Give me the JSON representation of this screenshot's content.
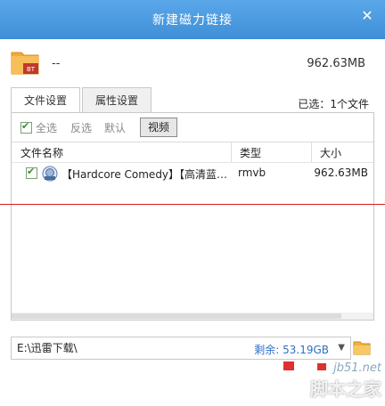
{
  "window": {
    "title": "新建磁力链接",
    "close_glyph": "✕"
  },
  "torrent": {
    "name": "--",
    "size": "962.63MB",
    "icon_badge": "BT"
  },
  "tabs": [
    {
      "label": "文件设置",
      "active": true
    },
    {
      "label": "属性设置",
      "active": false
    }
  ],
  "selection_status": "已选：1个文件",
  "toolbar": {
    "select_all": "全选",
    "invert": "反选",
    "default": "默认",
    "video": "视频"
  },
  "table": {
    "headers": {
      "name": "文件名称",
      "type": "类型",
      "size": "大小"
    },
    "rows": [
      {
        "checked": true,
        "icon": "rm-file-icon",
        "name": "【Hardcore Comedy】【高清蓝光...",
        "type": "rmvb",
        "size": "962.63MB"
      }
    ]
  },
  "save": {
    "path": "E:\\迅雷下载\\",
    "free_space": "剩余: 53.19GB"
  },
  "watermark": {
    "site": "jb51.net",
    "name": "脚本之家"
  },
  "colors": {
    "titlebar": "#4b9be2",
    "accent_link": "#2e6fc7",
    "check": "#3e8e2a"
  }
}
